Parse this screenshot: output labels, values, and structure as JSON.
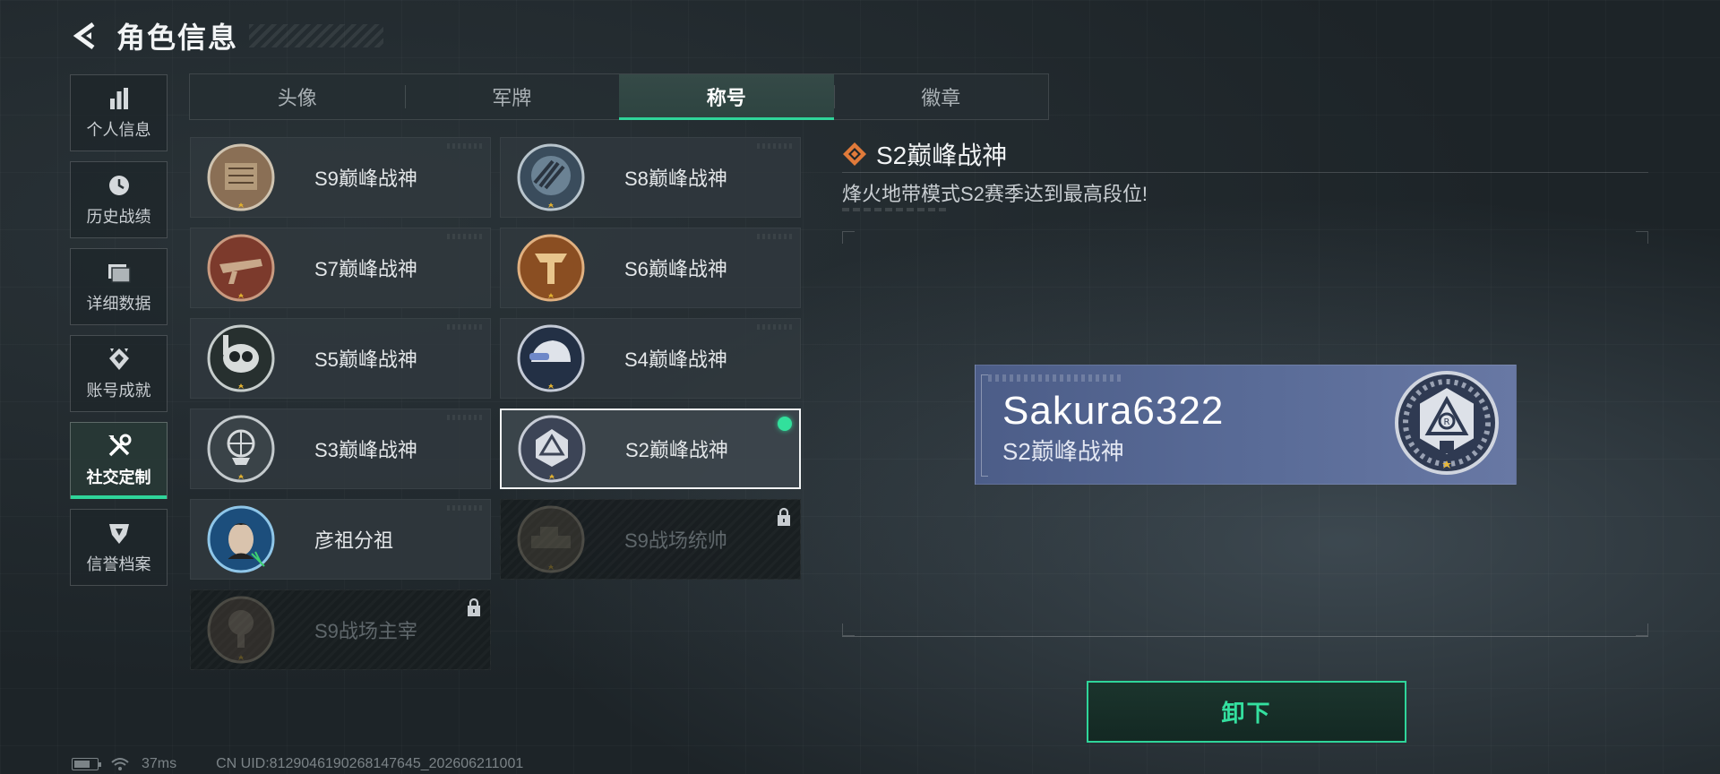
{
  "header": {
    "title": "角色信息"
  },
  "sidebar": {
    "items": [
      {
        "label": "个人信息",
        "icon": "bar-chart-icon",
        "active": false
      },
      {
        "label": "历史战绩",
        "icon": "clock-icon",
        "active": false
      },
      {
        "label": "详细数据",
        "icon": "folder-icon",
        "active": false
      },
      {
        "label": "账号成就",
        "icon": "achievement-icon",
        "active": false
      },
      {
        "label": "社交定制",
        "icon": "tools-icon",
        "active": true
      },
      {
        "label": "信誉档案",
        "icon": "shield-icon",
        "active": false
      }
    ]
  },
  "tabs": [
    {
      "label": "头像",
      "active": false
    },
    {
      "label": "军牌",
      "active": false
    },
    {
      "label": "称号",
      "active": true
    },
    {
      "label": "徽章",
      "active": false
    }
  ],
  "titles": [
    {
      "label": "S9巅峰战神",
      "locked": false,
      "selected": false,
      "badge_color": "#8a6f55"
    },
    {
      "label": "S8巅峰战神",
      "locked": false,
      "selected": false,
      "badge_color": "#4d6578"
    },
    {
      "label": "S7巅峰战神",
      "locked": false,
      "selected": false,
      "badge_color": "#7c3a2c"
    },
    {
      "label": "S6巅峰战神",
      "locked": false,
      "selected": false,
      "badge_color": "#8a4e22"
    },
    {
      "label": "S5巅峰战神",
      "locked": false,
      "selected": false,
      "badge_color": "#2f3a38"
    },
    {
      "label": "S4巅峰战神",
      "locked": false,
      "selected": false,
      "badge_color": "#2e3a50"
    },
    {
      "label": "S3巅峰战神",
      "locked": false,
      "selected": false,
      "badge_color": "#4a545a"
    },
    {
      "label": "S2巅峰战神",
      "locked": false,
      "selected": true,
      "badge_color": "#55607a"
    },
    {
      "label": "彦祖分祖",
      "locked": false,
      "selected": false,
      "badge_color": "#1f5a8a"
    },
    {
      "label": "S9战场统帅",
      "locked": true,
      "selected": false,
      "badge_color": "#5a5040"
    },
    {
      "label": "S9战场主宰",
      "locked": true,
      "selected": false,
      "badge_color": "#5a4a3e"
    }
  ],
  "detail": {
    "title": "S2巅峰战神",
    "description": "烽火地带模式S2赛季达到最高段位!"
  },
  "nameplate": {
    "player_name": "Sakura6322",
    "title": "S2巅峰战神"
  },
  "actions": {
    "unequip_label": "卸下"
  },
  "footer": {
    "ping": "37ms",
    "uid": "CN UID:8129046190268147645_202606211001"
  },
  "colors": {
    "accent": "#2fd59a",
    "nameplate": "#5a6c98"
  }
}
